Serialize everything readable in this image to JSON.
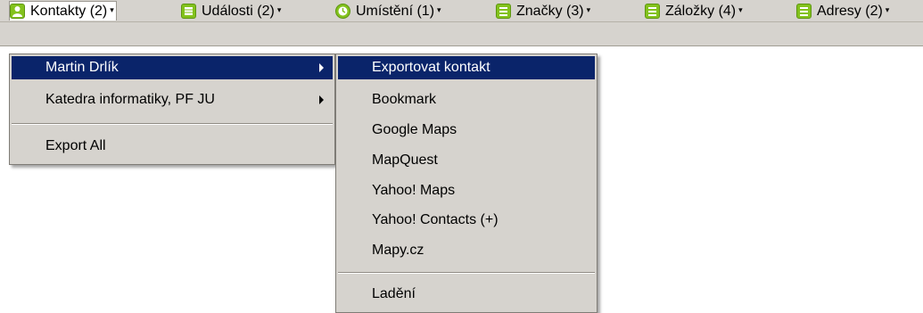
{
  "toolbar": {
    "buttons": [
      {
        "label": "Kontakty (2)",
        "icon": "contact-icon"
      },
      {
        "label": "Události (2)",
        "icon": "calendar-icon"
      },
      {
        "label": "Umístění (1)",
        "icon": "location-icon"
      },
      {
        "label": "Značky (3)",
        "icon": "list-icon"
      },
      {
        "label": "Záložky (4)",
        "icon": "list-icon"
      },
      {
        "label": "Adresy (2)",
        "icon": "list-icon"
      }
    ],
    "dropdown_arrow": "▾",
    "icon_color": "#83c21d"
  },
  "contacts_menu": {
    "items": [
      "Martin Drlík",
      "Katedra informatiky, PF JU"
    ],
    "export_all": "Export All"
  },
  "submenu": {
    "items": [
      "Exportovat kontakt",
      "Bookmark",
      "Google Maps",
      "MapQuest",
      "Yahoo! Maps",
      "Yahoo! Contacts (+)",
      "Mapy.cz"
    ],
    "debug": "Ladění"
  },
  "colors": {
    "highlight": "#0a246a",
    "menu_bg": "#d6d3ce"
  }
}
